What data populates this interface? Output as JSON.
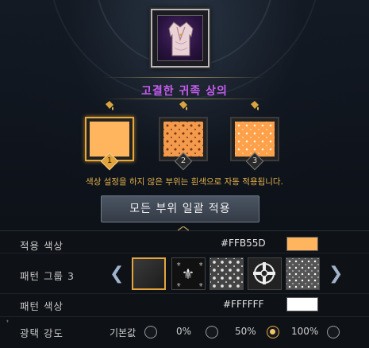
{
  "item": {
    "name": "고결한 귀족 상의",
    "icon": "noble-top-icon"
  },
  "slots": [
    {
      "number": "1",
      "color": "#FFB55D",
      "pattern": "solid",
      "active": true
    },
    {
      "number": "2",
      "color": "#FF9A4A",
      "pattern": "ornate",
      "active": false
    },
    {
      "number": "3",
      "color": "#FFA24E",
      "pattern": "ornate",
      "active": false
    }
  ],
  "notice": "색상 설정을 하지 않은 부위는 흰색으로 자동 적용됩니다.",
  "apply_all_button": "모든 부위 일괄 적용",
  "apply_color": {
    "label": "적용 색상",
    "hex": "#FFB55D",
    "swatch": "#FFB55D"
  },
  "pattern_group": {
    "label": "패턴 그룹 3",
    "prev_icon": "chevron-left-icon",
    "next_icon": "chevron-right-icon",
    "patterns": [
      "blank",
      "fleur-de-lis",
      "damask",
      "cross-ornament",
      "floral"
    ],
    "selected_index": 0
  },
  "pattern_color": {
    "label": "패턴 색상",
    "hex": "#FFFFFF",
    "swatch": "#FFFFFF"
  },
  "gloss": {
    "label": "광택 강도",
    "options": [
      "기본값",
      "0%",
      "50%",
      "100%"
    ],
    "selected_index": 2
  },
  "colors": {
    "name": "#c65cf0",
    "accent": "#e8a93a",
    "notice": "#e4b24a"
  }
}
